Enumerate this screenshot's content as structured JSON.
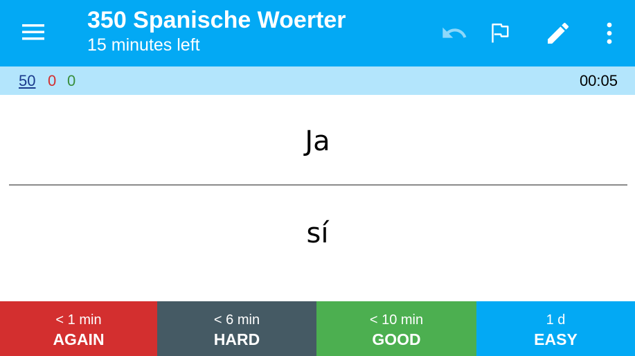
{
  "appbar": {
    "title": "350 Spanische Woerter",
    "subtitle": "15 minutes left",
    "icons": [
      "menu-icon",
      "undo-icon",
      "flag-icon",
      "edit-icon",
      "more-vert-icon"
    ],
    "color": "#03a9f4"
  },
  "status": {
    "new_count": "50",
    "learning_count": "0",
    "review_count": "0",
    "timer": "00:05",
    "colors": {
      "new": "#1a3a8c",
      "learning": "#d32f2f",
      "review": "#388e3c",
      "background": "#b3e5fc"
    }
  },
  "card": {
    "front": "Ja",
    "back": "sí"
  },
  "answers": [
    {
      "interval": "< 1 min",
      "label": "AGAIN",
      "color": "#d32f2f"
    },
    {
      "interval": "< 6 min",
      "label": "HARD",
      "color": "#455a64"
    },
    {
      "interval": "< 10 min",
      "label": "GOOD",
      "color": "#4caf50"
    },
    {
      "interval": "1 d",
      "label": "EASY",
      "color": "#03a9f4"
    }
  ]
}
